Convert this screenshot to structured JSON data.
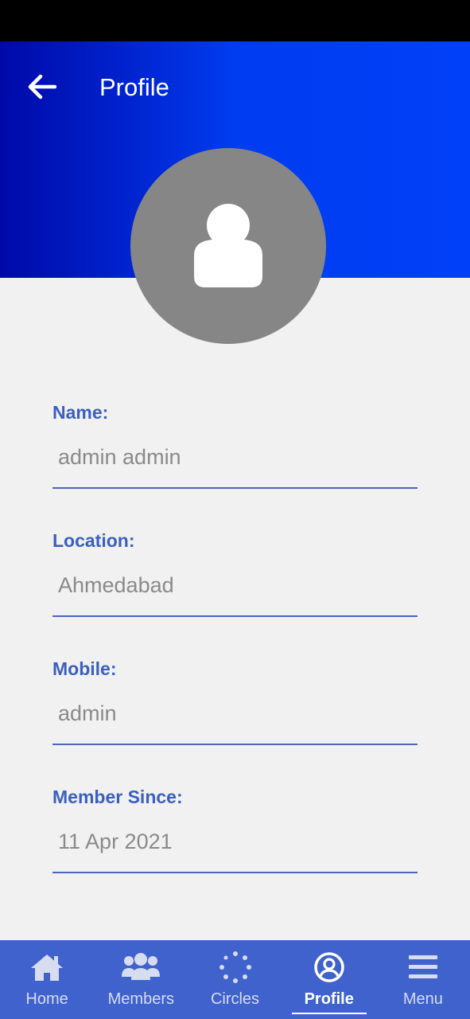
{
  "header": {
    "title": "Profile",
    "back_icon": "arrow-left-icon"
  },
  "avatar": {
    "icon": "user-icon"
  },
  "fields": [
    {
      "label": "Name:",
      "value": "admin admin"
    },
    {
      "label": "Location:",
      "value": "Ahmedabad"
    },
    {
      "label": "Mobile:",
      "value": "admin"
    },
    {
      "label": "Member Since:",
      "value": "11 Apr 2021"
    }
  ],
  "nav": [
    {
      "label": "Home",
      "icon": "home-icon",
      "active": false
    },
    {
      "label": "Members",
      "icon": "members-icon",
      "active": false
    },
    {
      "label": "Circles",
      "icon": "circles-icon",
      "active": false
    },
    {
      "label": "Profile",
      "icon": "profile-icon",
      "active": true
    },
    {
      "label": "Menu",
      "icon": "menu-icon",
      "active": false
    }
  ],
  "colors": {
    "header_start": "#0009a8",
    "header_end": "#0040f8",
    "label": "#3b5fc0",
    "nav_bg": "#3f62cc",
    "avatar_bg": "#868686"
  }
}
